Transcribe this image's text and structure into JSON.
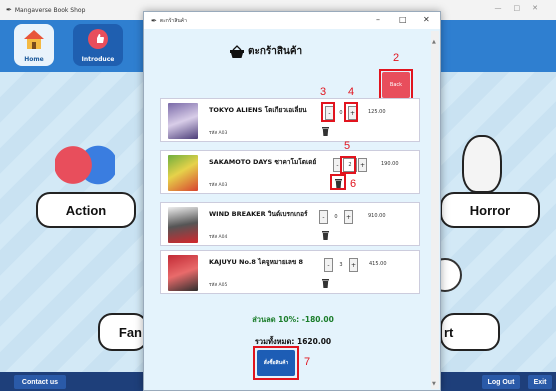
{
  "main_window": {
    "title": "Mangaverse Book Shop",
    "nav": {
      "home_label": "Home",
      "introduce_label": "Introduce"
    },
    "categories": [
      "Action",
      "Horror",
      "Fan",
      "rt"
    ],
    "footer": {
      "contact_label": "Contact us",
      "logout_label": "Log Out",
      "exit_label": "Exit"
    }
  },
  "dialog": {
    "title": "ตะกร้าสินค้า",
    "heading": "ตะกร้าสินค้า",
    "back_label": "Back",
    "items": [
      {
        "title": "TOKYO ALIENS โตเกียวเอเลี่ยน",
        "code": "รหัส A03",
        "qty": "0",
        "price": "125.00"
      },
      {
        "title": "SAKAMOTO DAYS ซาคาโมโตเดย์",
        "code": "รหัส A03",
        "qty": "2",
        "price": "190.00"
      },
      {
        "title": "WIND BREAKER วินด์เบรกเกอร์",
        "code": "รหัส A04",
        "qty": "0",
        "price": "910.00"
      },
      {
        "title": "KAJUYU No.8 ไคจูหมายเลข 8",
        "code": "รหัส A05",
        "qty": "3",
        "price": "415.00"
      }
    ],
    "discount_text": "ส่วนลด 10%: -180.00",
    "total_text": "รวมทั้งหมด: 1620.00",
    "checkout_label": "สั่งซื้อสินค้า"
  },
  "annotations": [
    "2",
    "3",
    "4",
    "5",
    "6",
    "7"
  ],
  "colors": {
    "header": "#2f7fd0",
    "back": "#e84e5c",
    "checkout": "#1d5db5",
    "annotation": "#e1141e",
    "discount": "#1a7d2a"
  }
}
